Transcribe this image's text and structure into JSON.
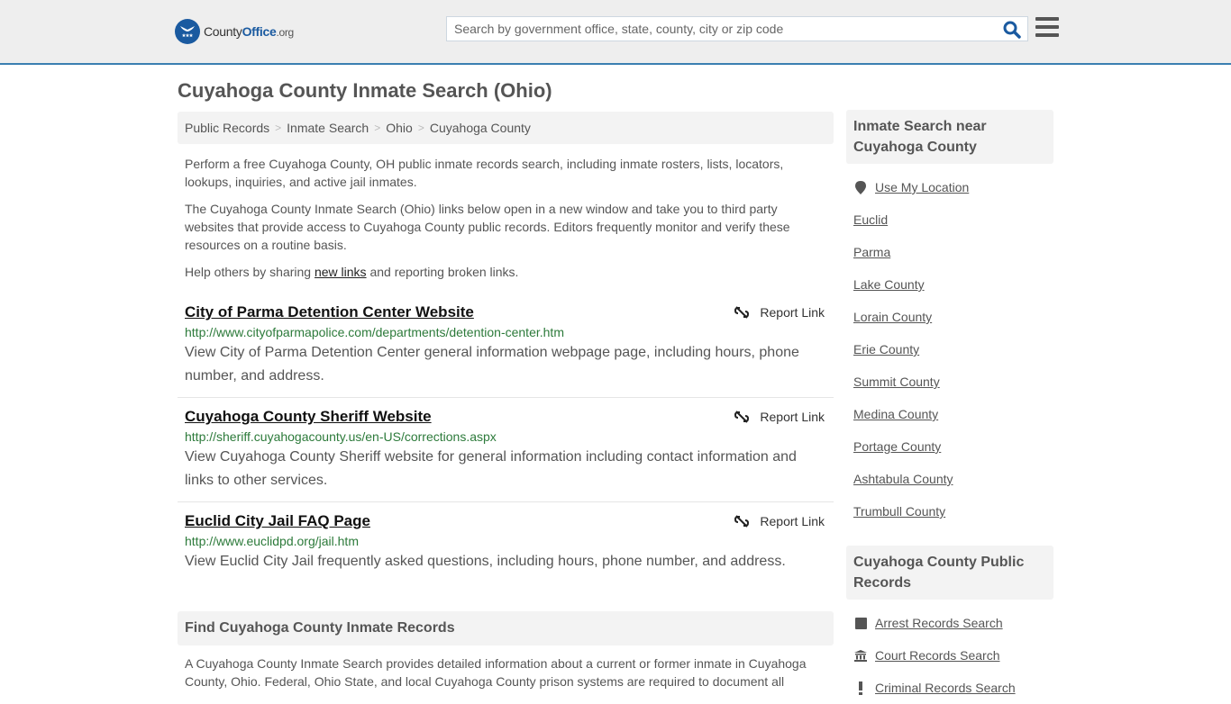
{
  "header": {
    "logo": {
      "name": "County",
      "brand": "Office",
      "tld": ".org"
    },
    "search": {
      "placeholder": "Search by government office, state, county, city or zip code",
      "value": ""
    },
    "border_color": "#3b7fb1"
  },
  "page": {
    "title": "Cuyahoga County Inmate Search (Ohio)"
  },
  "breadcrumb": [
    {
      "label": "Public Records"
    },
    {
      "label": "Inmate Search"
    },
    {
      "label": "Ohio"
    },
    {
      "label": "Cuyahoga County"
    }
  ],
  "intro": {
    "p1": "Perform a free Cuyahoga County, OH public inmate records search, including inmate rosters, lists, locators, lookups, inquiries, and active jail inmates.",
    "p2": "The Cuyahoga County Inmate Search (Ohio) links below open in a new window and take you to third party websites that provide access to Cuyahoga County public records. Editors frequently monitor and verify these resources on a routine basis.",
    "p3_before": "Help others by sharing ",
    "p3_link": "new links",
    "p3_after": " and reporting broken links."
  },
  "results": [
    {
      "title": "City of Parma Detention Center Website",
      "url": "http://www.cityofparmapolice.com/departments/detention-center.htm",
      "description": "View City of Parma Detention Center general information webpage page, including hours, phone number, and address.",
      "report_label": "Report Link"
    },
    {
      "title": "Cuyahoga County Sheriff Website",
      "url": "http://sheriff.cuyahogacounty.us/en-US/corrections.aspx",
      "description": "View Cuyahoga County Sheriff website for general information including contact information and links to other services.",
      "report_label": "Report Link"
    },
    {
      "title": "Euclid City Jail FAQ Page",
      "url": "http://www.euclidpd.org/jail.htm",
      "description": "View Euclid City Jail frequently asked questions, including hours, phone number, and address.",
      "report_label": "Report Link"
    }
  ],
  "find_section": {
    "heading": "Find Cuyahoga County Inmate Records",
    "body": "A Cuyahoga County Inmate Search provides detailed information about a current or former inmate in Cuyahoga County, Ohio. Federal, Ohio State, and local Cuyahoga County prison systems are required to document all"
  },
  "sidebar": {
    "nearby": {
      "heading": "Inmate Search near Cuyahoga County",
      "use_location": {
        "label": "Use My Location",
        "icon": "map-pin-icon"
      },
      "links": [
        "Euclid",
        "Parma",
        "Lake County",
        "Lorain County",
        "Erie County",
        "Summit County",
        "Medina County",
        "Portage County",
        "Ashtabula County",
        "Trumbull County"
      ]
    },
    "public_records": {
      "heading": "Cuyahoga County Public Records",
      "links": [
        {
          "label": "Arrest Records Search",
          "icon": "square-icon"
        },
        {
          "label": "Court Records Search",
          "icon": "courthouse-icon"
        },
        {
          "label": "Criminal Records Search",
          "icon": "exclamation-icon"
        }
      ]
    }
  }
}
